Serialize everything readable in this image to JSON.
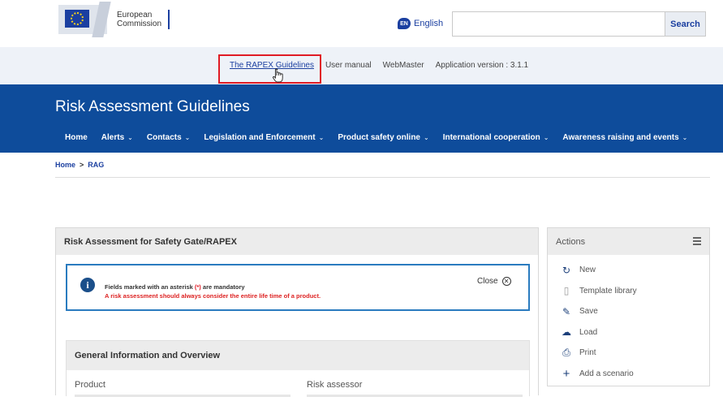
{
  "header": {
    "logo_line1": "European",
    "logo_line2": "Commission",
    "language_code": "EN",
    "language": "English",
    "search_placeholder": "",
    "search_button": "Search"
  },
  "utility_links": {
    "rapex_guidelines": "The RAPEX Guidelines",
    "user_manual": "User manual",
    "webmaster": "WebMaster",
    "app_version": "Application version : 3.1.1"
  },
  "site": {
    "title": "Risk Assessment Guidelines"
  },
  "nav": {
    "items": [
      {
        "label": "Home",
        "dropdown": false
      },
      {
        "label": "Alerts",
        "dropdown": true
      },
      {
        "label": "Contacts",
        "dropdown": true
      },
      {
        "label": "Legislation and Enforcement",
        "dropdown": true
      },
      {
        "label": "Product safety online",
        "dropdown": true
      },
      {
        "label": "International cooperation",
        "dropdown": true
      },
      {
        "label": "Awareness raising and events",
        "dropdown": true
      }
    ],
    "chevron": "⌄"
  },
  "breadcrumb": {
    "home": "Home",
    "separator": ">",
    "current": "RAG"
  },
  "main_panel": {
    "title": "Risk Assessment for Safety Gate/RAPEX",
    "notice": {
      "line1_prefix": "Fields marked with an asterisk ",
      "line1_asterisk": "(*)",
      "line1_suffix": " are mandatory",
      "line2": "A risk assessment should always consider the entire life time of a product.",
      "close_label": "Close"
    },
    "general_info": {
      "title": "General Information and Overview",
      "product_label": "Product",
      "risk_assessor_label": "Risk assessor"
    }
  },
  "actions_panel": {
    "title": "Actions",
    "items": [
      {
        "label": "New",
        "icon": "refresh-icon"
      },
      {
        "label": "Template library",
        "icon": "book-icon"
      },
      {
        "label": "Save",
        "icon": "pencil-icon"
      },
      {
        "label": "Load",
        "icon": "cloud-upload-icon"
      },
      {
        "label": "Print",
        "icon": "printer-icon"
      },
      {
        "label": "Add a scenario",
        "icon": "plus-icon"
      }
    ]
  },
  "colors": {
    "brand_blue": "#0e4c9b",
    "highlight_red": "#e01b24",
    "notice_border": "#2a7bbf"
  }
}
